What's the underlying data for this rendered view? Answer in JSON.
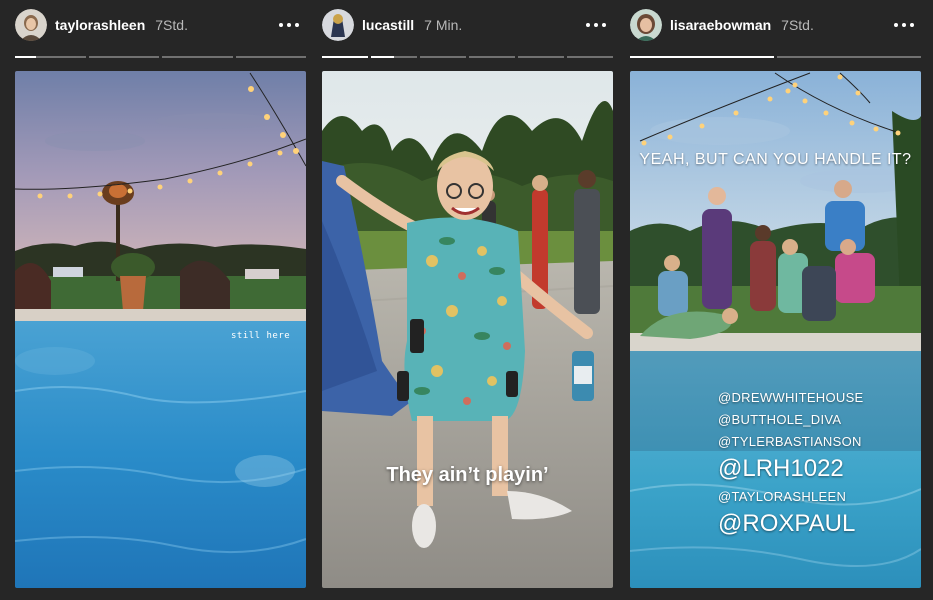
{
  "stories": [
    {
      "username": "taylorashleen",
      "time": "7Std.",
      "segments": [
        0.3,
        0,
        0,
        0
      ],
      "overlay_text": "still here"
    },
    {
      "username": "lucastill",
      "time": "7 Min.",
      "segments": [
        1,
        0.5,
        0,
        0,
        0,
        0
      ],
      "overlay_text": "They ain’t playin’"
    },
    {
      "username": "lisaraebowman",
      "time": "7Std.",
      "segments": [
        1,
        0
      ],
      "overlay_text": "YEAH, BUT CAN YOU HANDLE IT?",
      "mentions": [
        "@DREWWHITEHOUSE",
        "@BUTTHOLE_DIVA",
        "@TYLERBASTIANSON",
        "@LRH1022",
        "@TAYLORASHLEEN",
        "@ROXPAUL"
      ]
    }
  ],
  "icons": {
    "more": "more-horizontal-icon"
  },
  "colors": {
    "background": "#262626",
    "text_secondary": "#b9b9b9",
    "progress_active": "#ffffff",
    "progress_inactive": "rgba(255,255,255,0.35)"
  }
}
